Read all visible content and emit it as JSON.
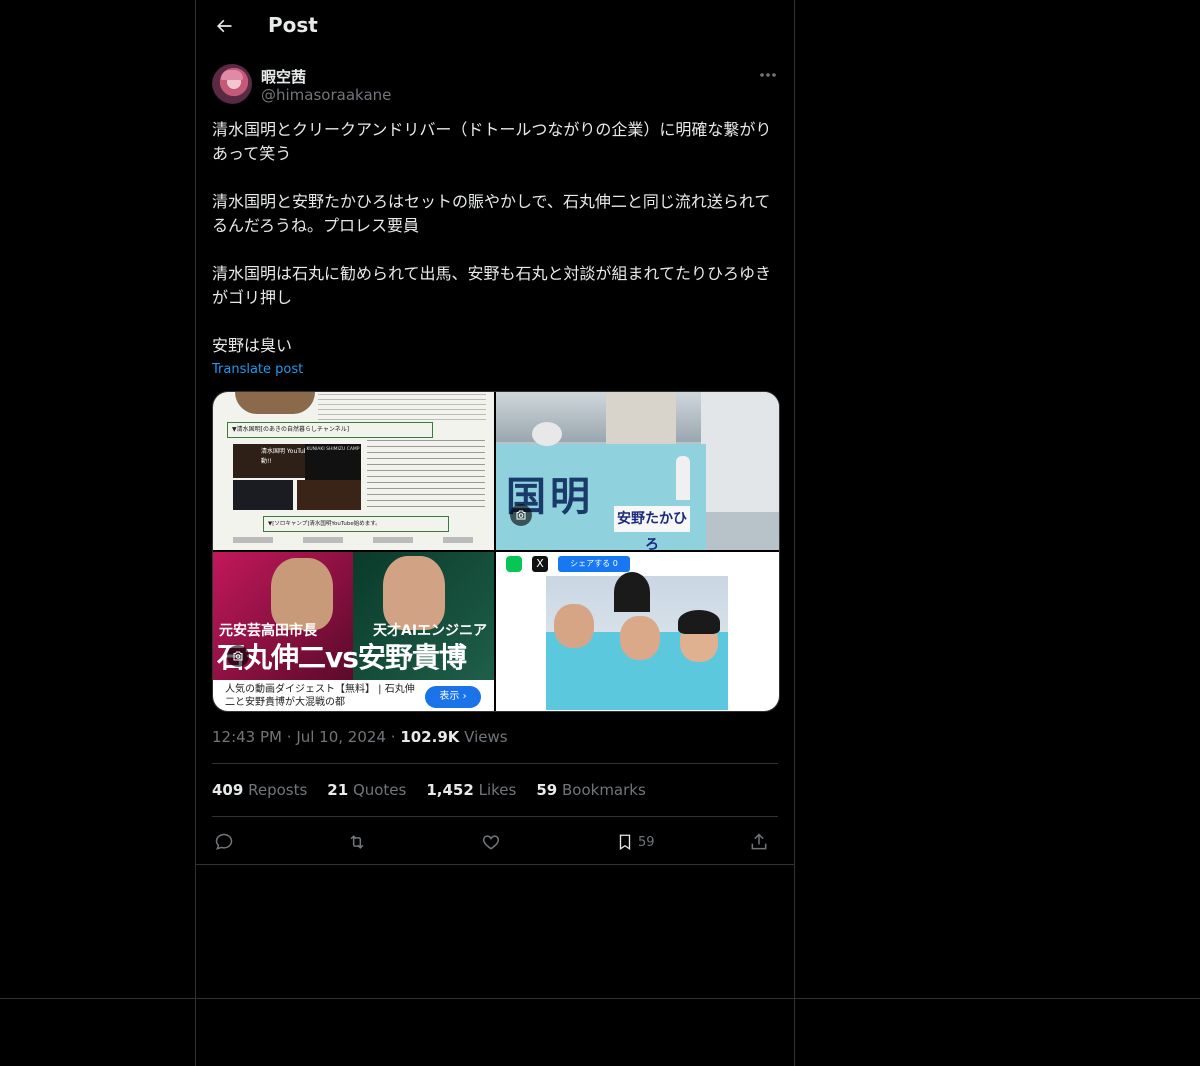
{
  "header": {
    "title": "Post"
  },
  "author": {
    "display_name": "暇空茜",
    "handle": "@himasoraakane"
  },
  "post": {
    "paragraphs": [
      "清水国明とクリークアンドリバー（ドトールつながりの企業）に明確な繋がりあって笑う",
      "清水国明と安野たかひろはセットの賑やかしで、石丸伸二と同じ流れ送られてるんだろうね。プロレス要員",
      "清水国明は石丸に勧められて出馬、安野も石丸と対談が組まれてたりひろゆきがゴリ押し",
      "安野は臭い"
    ],
    "translate_label": "Translate post",
    "time": "12:43 PM",
    "date": "Jul 10, 2024",
    "views_count": "102.9K",
    "views_label": "Views"
  },
  "stats": {
    "reposts_count": "409",
    "reposts_label": "Reposts",
    "quotes_count": "21",
    "quotes_label": "Quotes",
    "likes_count": "1,452",
    "likes_label": "Likes",
    "bookmarks_count": "59",
    "bookmarks_label": "Bookmarks"
  },
  "actions": {
    "bookmark_count": "59"
  },
  "media": {
    "img1": {
      "heading": "▼清水国明[のあきの自然暮らしチャンネル]",
      "badge": "清水国明 YouTube 始動!!",
      "logo": "KUNIAKI SHIMIZU CAMP",
      "footer": "▼[ソロキャンプ]清水国明YouTube始めます。"
    },
    "img2": {
      "sign_big": "国明",
      "sign_name": "安野たかひろ"
    },
    "img3": {
      "label_left": "元安芸高田市長",
      "label_right": "天才AIエンジニア",
      "headline": "石丸伸二vs安野貴博",
      "ad_text": "人気の動画ダイジェスト【無料】 | 石丸伸二と安野貴博が大混戦の都",
      "ad_button": "表示 ›"
    },
    "img4": {
      "share_label": "シェアする 0"
    }
  },
  "colors": {
    "accent": "#1d9bf0",
    "muted": "#71767b",
    "text": "#e7e9ea",
    "border": "#2f3336"
  }
}
